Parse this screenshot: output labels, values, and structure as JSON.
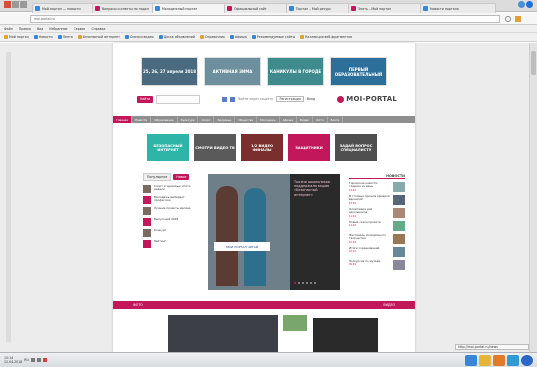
{
  "browser": {
    "tabs": [
      {
        "label": "Мой-портал — новости"
      },
      {
        "label": "Вопросы и ответы по подкл"
      },
      {
        "label": "Молодежный портал"
      },
      {
        "label": "Официальный сайт"
      },
      {
        "label": "Портал – Мой ресурс"
      },
      {
        "label": "Знать – Мой портал"
      },
      {
        "label": "Новости портала"
      }
    ],
    "address": "moi-portal.ru",
    "menu": [
      "Файл",
      "Правка",
      "Вид",
      "Избранное",
      "Сервис",
      "Справка"
    ],
    "bookmarks": [
      "Мой портал",
      "Новости",
      "Лента",
      "Безопасный интернет",
      "Смотри видео",
      "Доска объявлений",
      "Справочник",
      "Афиша",
      "Рекомендуемые сайты",
      "Коллекция веб-фрагментов"
    ]
  },
  "site": {
    "logo": "MOI-PORTAL",
    "search_button": "Найти",
    "search_placeholder": "",
    "login_links": "Войти через соцсети",
    "header_links": [
      "Регистрация",
      "Вход"
    ],
    "banners": [
      {
        "text": "25, 26, 27 апреля 2018",
        "color": "#4a6a80"
      },
      {
        "text": "АКТИВНАЯ ЗИМА",
        "color": "#6d8f9e"
      },
      {
        "text": "КАНИКУЛЫ В ГОРОДЕ",
        "color": "#3f8a8c"
      },
      {
        "text": "ПЕРВЫЙ ОБРАЗОВАТЕЛЬНЫЙ",
        "color": "#2b6f9a"
      }
    ],
    "nav": [
      "Главная",
      "Новости",
      "Образование",
      "Культура",
      "Спорт",
      "Здоровье",
      "Общество",
      "Молодежь",
      "Афиша",
      "Видео",
      "Фото",
      "Блоги"
    ],
    "tiles": [
      {
        "text": "БЕЗОПАСНЫЙ ИНТЕРНЕТ",
        "color": "#2fb5a8"
      },
      {
        "text": "СМОТРИ ВИДЕО ТВ",
        "color": "#5a5a5a"
      },
      {
        "text": "1/2 ВИДЕО ФИНАЛЫ",
        "color": "#7b2e2e"
      },
      {
        "text": "ЗАЩИТНИКИ",
        "color": "#c2185b"
      },
      {
        "text": "ЗАДАЙ ВОПРОС СПЕЦИАЛИСТУ",
        "color": "#4f4f4f"
      }
    ],
    "left_tabs": [
      "Популярное",
      "Новое"
    ],
    "left_items": [
      {
        "text": "Спорт и здоровье: итоги недели"
      },
      {
        "text": "Молодёжь выбирает профессию"
      },
      {
        "text": "Лучшие проекты месяца"
      },
      {
        "text": "Выпускной 2018"
      },
      {
        "text": "Конкурс"
      },
      {
        "text": "Рейтинг"
      }
    ],
    "hero_caption": "Тысячи школьников поддержали акцию «Безопасный интернет»",
    "hero_overlay": "МОИ ПОРТАЛ ЧИТАЙ",
    "news_title": "НОВОСТИ",
    "news_items": [
      {
        "text": "Городские новости: главное за день",
        "date": "12.04"
      },
      {
        "text": "В столице прошла ярмарка вакансий",
        "date": "12.04"
      },
      {
        "text": "Олимпиада для школьников",
        "date": "11.04"
      },
      {
        "text": "Новый сезон проекта",
        "date": "11.04"
      },
      {
        "text": "Фестиваль молодёжного творчества",
        "date": "10.04"
      },
      {
        "text": "Итоги соревнований",
        "date": "10.04"
      },
      {
        "text": "Экскурсия по музеям",
        "date": "09.04"
      }
    ],
    "section_left": "ВИДЕО",
    "section_right": "ФОТО"
  },
  "taskbar": {
    "time": "15:14",
    "date": "12.04.2018",
    "lang": "RU",
    "status_url": "http://moi-portal.ru/news"
  },
  "colors": {
    "accent": "#c2185b",
    "nav": "#8f8f8f"
  }
}
